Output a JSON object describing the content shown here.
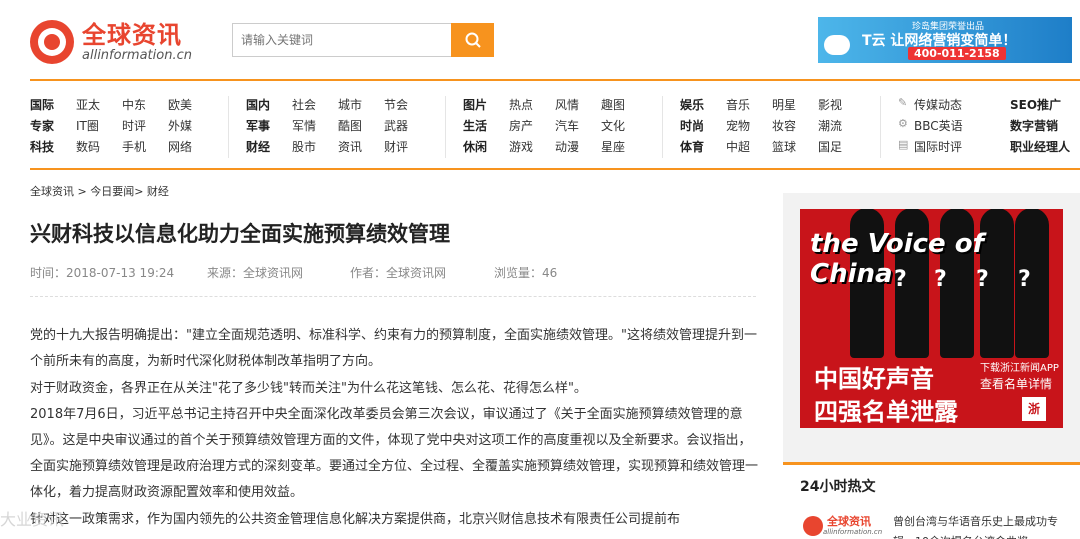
{
  "header": {
    "logo_cn": "全球资讯",
    "logo_en": "allinformation.cn",
    "search_placeholder": "请输入关键词",
    "banner": {
      "line1": "珍岛集团荣誉出品",
      "line2": "T云 让网络营销变简单！",
      "phone": "400-011-2158"
    }
  },
  "nav": {
    "groups": [
      {
        "rows": [
          [
            "国际",
            "亚太",
            "中东",
            "欧美"
          ],
          [
            "专家",
            "IT圈",
            "时评",
            "外媒"
          ],
          [
            "科技",
            "数码",
            "手机",
            "网络"
          ]
        ]
      },
      {
        "rows": [
          [
            "国内",
            "社会",
            "城市",
            "节会"
          ],
          [
            "军事",
            "军情",
            "酷图",
            "武器"
          ],
          [
            "财经",
            "股市",
            "资讯",
            "财评"
          ]
        ]
      },
      {
        "rows": [
          [
            "图片",
            "热点",
            "风情",
            "趣图"
          ],
          [
            "生活",
            "房产",
            "汽车",
            "文化"
          ],
          [
            "休闲",
            "游戏",
            "动漫",
            "星座"
          ]
        ]
      },
      {
        "rows": [
          [
            "娱乐",
            "音乐",
            "明星",
            "影视"
          ],
          [
            "时尚",
            "宠物",
            "妆容",
            "潮流"
          ],
          [
            "体育",
            "中超",
            "篮球",
            "国足"
          ]
        ]
      },
      {
        "rows": [
          [
            "传媒动态",
            "SEO推广"
          ],
          [
            "BBC英语",
            "数字营销"
          ],
          [
            "国际时评",
            "职业经理人"
          ]
        ]
      }
    ]
  },
  "breadcrumb": "全球资讯 > 今日要闻> 财经",
  "article": {
    "title": "兴财科技以信息化助力全面实施预算绩效管理",
    "time": "时间：2018-07-13 19:24",
    "source": "来源：全球资讯网",
    "author": "作者：全球资讯网",
    "views": "浏览量：46",
    "paragraphs": [
      "党的十九大报告明确提出：\"建立全面规范透明、标准科学、约束有力的预算制度，全面实施绩效管理。\"这将绩效管理提升到一个前所未有的高度，为新时代深化财税体制改革指明了方向。",
      "对于财政资金，各界正在从关注\"花了多少钱\"转而关注\"为什么花这笔钱、怎么花、花得怎么样\"。",
      "2018年7月6日，习近平总书记主持召开中央全面深化改革委员会第三次会议，审议通过了《关于全面实施预算绩效管理的意见》。这是中央审议通过的首个关于预算绩效管理方面的文件，体现了党中央对这项工作的高度重视以及全新要求。会议指出，全面实施预算绩效管理是政府治理方式的深刻变革。要通过全方位、全过程、全覆盖实施预算绩效管理，实现预算和绩效管理一体化，着力提高财政资源配置效率和使用效益。",
      "针对这一政策需求，作为国内领先的公共资金管理信息化解决方案提供商，北京兴财信息技术有限责任公司提前布"
    ]
  },
  "ad": {
    "voice": "the Voice of China",
    "line1": "中国好声音",
    "line2": "四强名单泄露",
    "side1": "下载浙江新闻APP",
    "side2": "查看名单详情",
    "badge": "浙"
  },
  "hot": {
    "title": "24小时热文",
    "logo_cn": "全球资讯",
    "logo_en": "allinformation.cn",
    "item": "曾创台湾与华语音乐史上最成功专辑，10余次提名台湾金曲奖"
  },
  "watermark": "大业资讯"
}
